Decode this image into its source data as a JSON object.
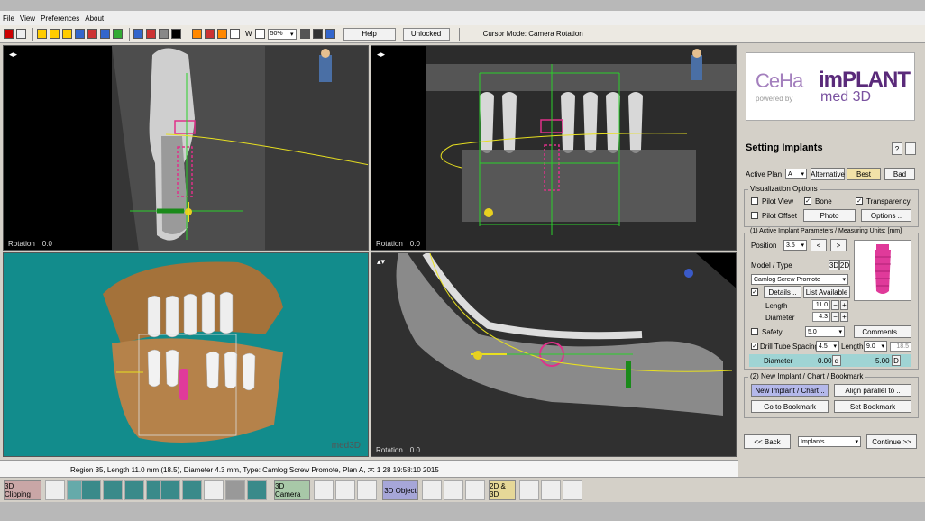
{
  "menu": [
    "File",
    "View",
    "Preferences",
    "About"
  ],
  "toolbar": {
    "w_label": "W",
    "zoom_value": "50%",
    "help_label": "Help",
    "lock_label": "Unlocked",
    "cursor_mode": "Cursor Mode: Camera Rotation"
  },
  "viewports": {
    "top_left": {
      "rotation_label": "Rotation",
      "rotation_value": "0.0"
    },
    "top_right": {
      "rotation_label": "Rotation",
      "rotation_value": "0.0"
    },
    "bottom_left": {
      "watermark": "med3D"
    },
    "bottom_right": {
      "rotation_label": "Rotation",
      "rotation_value": "0.0"
    }
  },
  "logo": {
    "ceha": "CeHa",
    "implant": "imPLANT",
    "powered": "powered by",
    "med3d": "med 3D"
  },
  "panel": {
    "title": "Setting Implants",
    "help": "?",
    "more": "...",
    "active_plan_label": "Active Plan",
    "active_plan_value": "A",
    "alternative_label": "Alternative",
    "best_label": "Best",
    "bad_label": "Bad",
    "viz": {
      "title": "Visualization Options",
      "pilot_view": "Pilot View",
      "bone": "Bone",
      "transparency": "Transparency",
      "pilot_offset": "Pilot Offset",
      "photo": "Photo",
      "options": "Options .."
    },
    "params": {
      "title": "(1) Active Implant Parameters / Measuring Units: [mm]",
      "position_label": "Position",
      "position_value": "3.5",
      "model_type_label": "Model / Type",
      "mode_3d": "3D",
      "mode_2d": "2D",
      "model_value": "Camlog Screw Promote",
      "details_label": "Details ..",
      "list_available": "List Available",
      "length_label": "Length",
      "length_value": "11.0",
      "diameter_label": "Diameter",
      "diameter_value": "4.3",
      "safety_label": "Safety",
      "safety_value": "5.0",
      "comments_label": "Comments ..",
      "drill_label": "Drill Tube Spacing",
      "drill_value": "4.5",
      "drill_length_label": "Length",
      "drill_length_value": "9.0",
      "drill_extra": "18.5",
      "drill_diameter_label": "Diameter",
      "drill_diameter_value": "0.00",
      "drill_d1": "d",
      "drill_diameter_value2": "5.00",
      "drill_d2": "D"
    },
    "new": {
      "title": "(2) New Implant / Chart / Bookmark",
      "new_implant": "New Implant / Chart ..",
      "align_parallel": "Align parallel to ..",
      "go_bookmark": "Go to Bookmark",
      "set_bookmark": "Set Bookmark"
    },
    "nav": {
      "back": "<<  Back",
      "section": "Implants",
      "continue": "Continue  >>"
    }
  },
  "status": "Region 35, Length 11.0 mm (18.5), Diameter 4.3 mm, Type: Camlog Screw Promote, Plan A, 木 1 28 19:58:10 2015",
  "bottom": {
    "clipping": "3D Clipping",
    "camera": "3D Camera",
    "object": "3D Object",
    "mode_2d3d": "2D & 3D"
  }
}
